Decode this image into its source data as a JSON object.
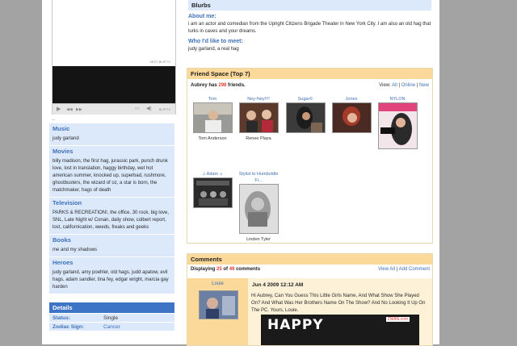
{
  "video": {
    "brand": "VIDIT BLIP.TV",
    "player_brand": "BLIP.TV"
  },
  "dots": "..",
  "interests": [
    {
      "key": "music",
      "title": "Music",
      "text": "judy garland"
    },
    {
      "key": "movies",
      "title": "Movies",
      "text": "billy madison, the first hag, jurassic park, punch drunk love, lost in translation, haggy birthday, wet hot american summer, knocked up, superbad, rushmore, ghostbusters, the wizard of oz, a star is born, the matchmaker, hags of death"
    },
    {
      "key": "television",
      "title": "Television",
      "text": "PARKS & RECREATION!, the office, 30 rock, big love, SNL, Late Night w/ Conan, daily show, colbert report, lost, californication, weeds, freaks and geeks"
    },
    {
      "key": "books",
      "title": "Books",
      "text": "me and my shadows"
    },
    {
      "key": "heroes",
      "title": "Heroes",
      "text": "judy garland, amy poehler, old hags, judd apatow, evil hags, adam sandler, tina fey, edgar wright, marcia gay harden"
    }
  ],
  "details": {
    "title": "Details",
    "status_label": "Status:",
    "status_value": "Single",
    "zodiac_label": "Zodiac Sign:",
    "zodiac_value": "Cancer"
  },
  "blurbs": {
    "title": "Blurbs",
    "about_title": "About me:",
    "about_text": "i am an actor and comedian from the Upright Citizens Brigade Theater in New York City. I am also an old hag that lurks in caves and your dreams.",
    "meet_title": "Who I'd like to meet:",
    "meet_text": "judy garland, a real hag"
  },
  "friends": {
    "title": "Friend Space (Top 7)",
    "count_prefix": "Aubrey has",
    "count": "298",
    "count_suffix": "friends.",
    "view_label": "View:",
    "view_all": "All",
    "view_online": "Online",
    "view_new": "New",
    "sep": "|",
    "items": [
      {
        "name": "Tom",
        "caption": "Tom Anderson"
      },
      {
        "name": "Ney-Ney!!!!",
        "caption": "Renee Plaza"
      },
      {
        "name": "Sugar©",
        "caption": ""
      },
      {
        "name": "Jones",
        "caption": ""
      },
      {
        "name": "NYLON",
        "caption": ""
      },
      {
        "name": "♫ Adam ♫",
        "caption": ""
      },
      {
        "name": "Stylist to Humboldts Fi...",
        "caption": "Linden Tyler"
      }
    ]
  },
  "comments": {
    "title": "Comments",
    "display_prefix": "Displaying",
    "shown": "25",
    "of": "of",
    "total": "49",
    "display_suffix": "comments",
    "view_all": "View All",
    "sep": "|",
    "add": "Add Comment",
    "first": {
      "author": "Louie",
      "date": "Jun 4 2009 12:12 AM",
      "text": "Hi Aubrey, Can You Guess This Little Girls Name, And What Show She Played On? And What Was Her Brothers Name On The Show? And No Looking It Up On The PC. Yours, Louie.",
      "banner_text": "HAPPY",
      "banner_mark": "ZWAN.com"
    }
  }
}
